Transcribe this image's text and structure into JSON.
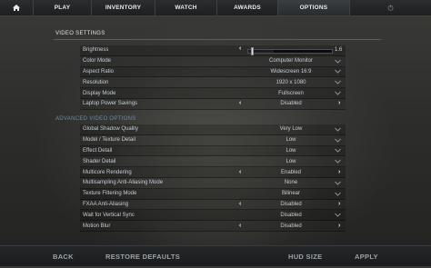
{
  "nav": {
    "home_icon": "home-icon",
    "items": [
      "PLAY",
      "INVENTORY",
      "WATCH",
      "AWARDS",
      "OPTIONS"
    ],
    "power_icon": "power-icon"
  },
  "video_settings": {
    "title": "VIDEO SETTINGS",
    "brightness": {
      "label": "Brightness",
      "value": "1.6",
      "level": 0.3
    },
    "rows": [
      {
        "label": "Color Mode",
        "value": "Computer Monitor",
        "control": "dropdown"
      },
      {
        "label": "Aspect Ratio",
        "value": "Widescreen 16:9",
        "control": "dropdown"
      },
      {
        "label": "Resolution",
        "value": "1920 x 1080",
        "control": "dropdown"
      },
      {
        "label": "Display Mode",
        "value": "Fullscreen",
        "control": "dropdown"
      },
      {
        "label": "Laptop Power Savings",
        "value": "Disabled",
        "control": "arrows"
      }
    ]
  },
  "advanced_video": {
    "title": "ADVANCED VIDEO OPTIONS",
    "rows": [
      {
        "label": "Global Shadow Quality",
        "value": "Very Low",
        "control": "dropdown"
      },
      {
        "label": "Model / Texture Detail",
        "value": "Low",
        "control": "dropdown"
      },
      {
        "label": "Effect Detail",
        "value": "Low",
        "control": "dropdown"
      },
      {
        "label": "Shader Detail",
        "value": "Low",
        "control": "dropdown"
      },
      {
        "label": "Multicore Rendering",
        "value": "Enabled",
        "control": "arrows"
      },
      {
        "label": "Multisampling Anti-Aliasing Mode",
        "value": "None",
        "control": "dropdown"
      },
      {
        "label": "Texture Filtering Mode",
        "value": "Bilinear",
        "control": "dropdown"
      },
      {
        "label": "FXAA Anti-Aliasing",
        "value": "Disabled",
        "control": "arrows"
      },
      {
        "label": "Wait for Vertical Sync",
        "value": "Disabled",
        "control": "dropdown"
      },
      {
        "label": "Motion Blur",
        "value": "Disabled",
        "control": "arrows"
      }
    ]
  },
  "bottom": {
    "back": "BACK",
    "restore": "RESTORE DEFAULTS",
    "hud": "HUD SIZE",
    "apply": "APPLY"
  },
  "colors": {
    "accent_section": "#6b8fa8",
    "text": "#c7ced4"
  }
}
